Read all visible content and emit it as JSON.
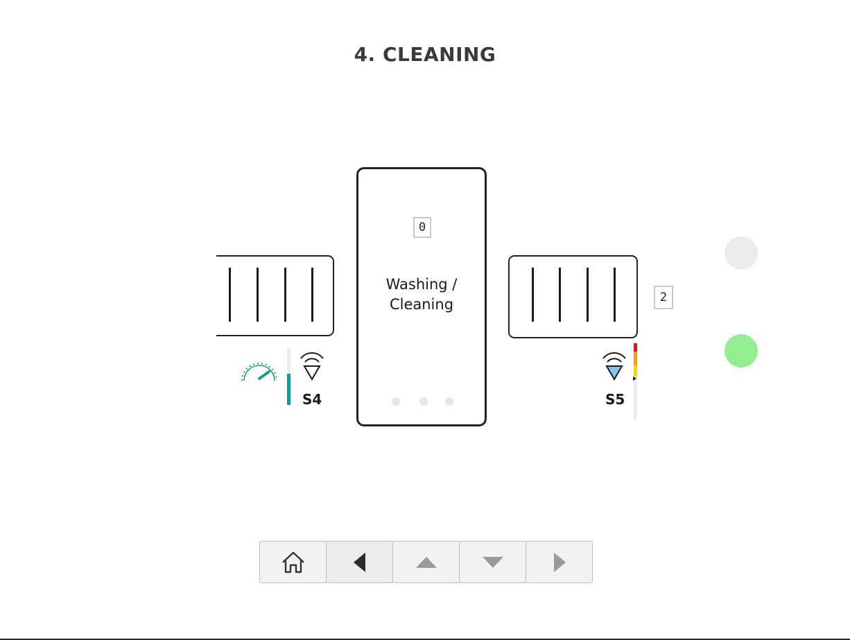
{
  "page": {
    "title": "4. CLEANING"
  },
  "washer": {
    "counter": "0",
    "label_line1": "Washing /",
    "label_line2": "Cleaning",
    "page_dots": 3
  },
  "station_right": {
    "counter": "2"
  },
  "sensors": {
    "s4": {
      "label": "S4",
      "level": 0.55,
      "color": "#139a9a",
      "icon": "speedometer-icon"
    },
    "s5": {
      "label": "S5",
      "icon": "proximity-sensor-icon",
      "fill": "#7fc4ea"
    }
  },
  "status_lights": [
    {
      "color": "#ebebeb"
    },
    {
      "color": "#90ee90"
    }
  ],
  "navbar": {
    "buttons": [
      {
        "icon": "home-icon"
      },
      {
        "icon": "arrow-left-icon"
      },
      {
        "icon": "arrow-up-icon"
      },
      {
        "icon": "arrow-down-icon"
      },
      {
        "icon": "arrow-right-icon"
      }
    ]
  }
}
